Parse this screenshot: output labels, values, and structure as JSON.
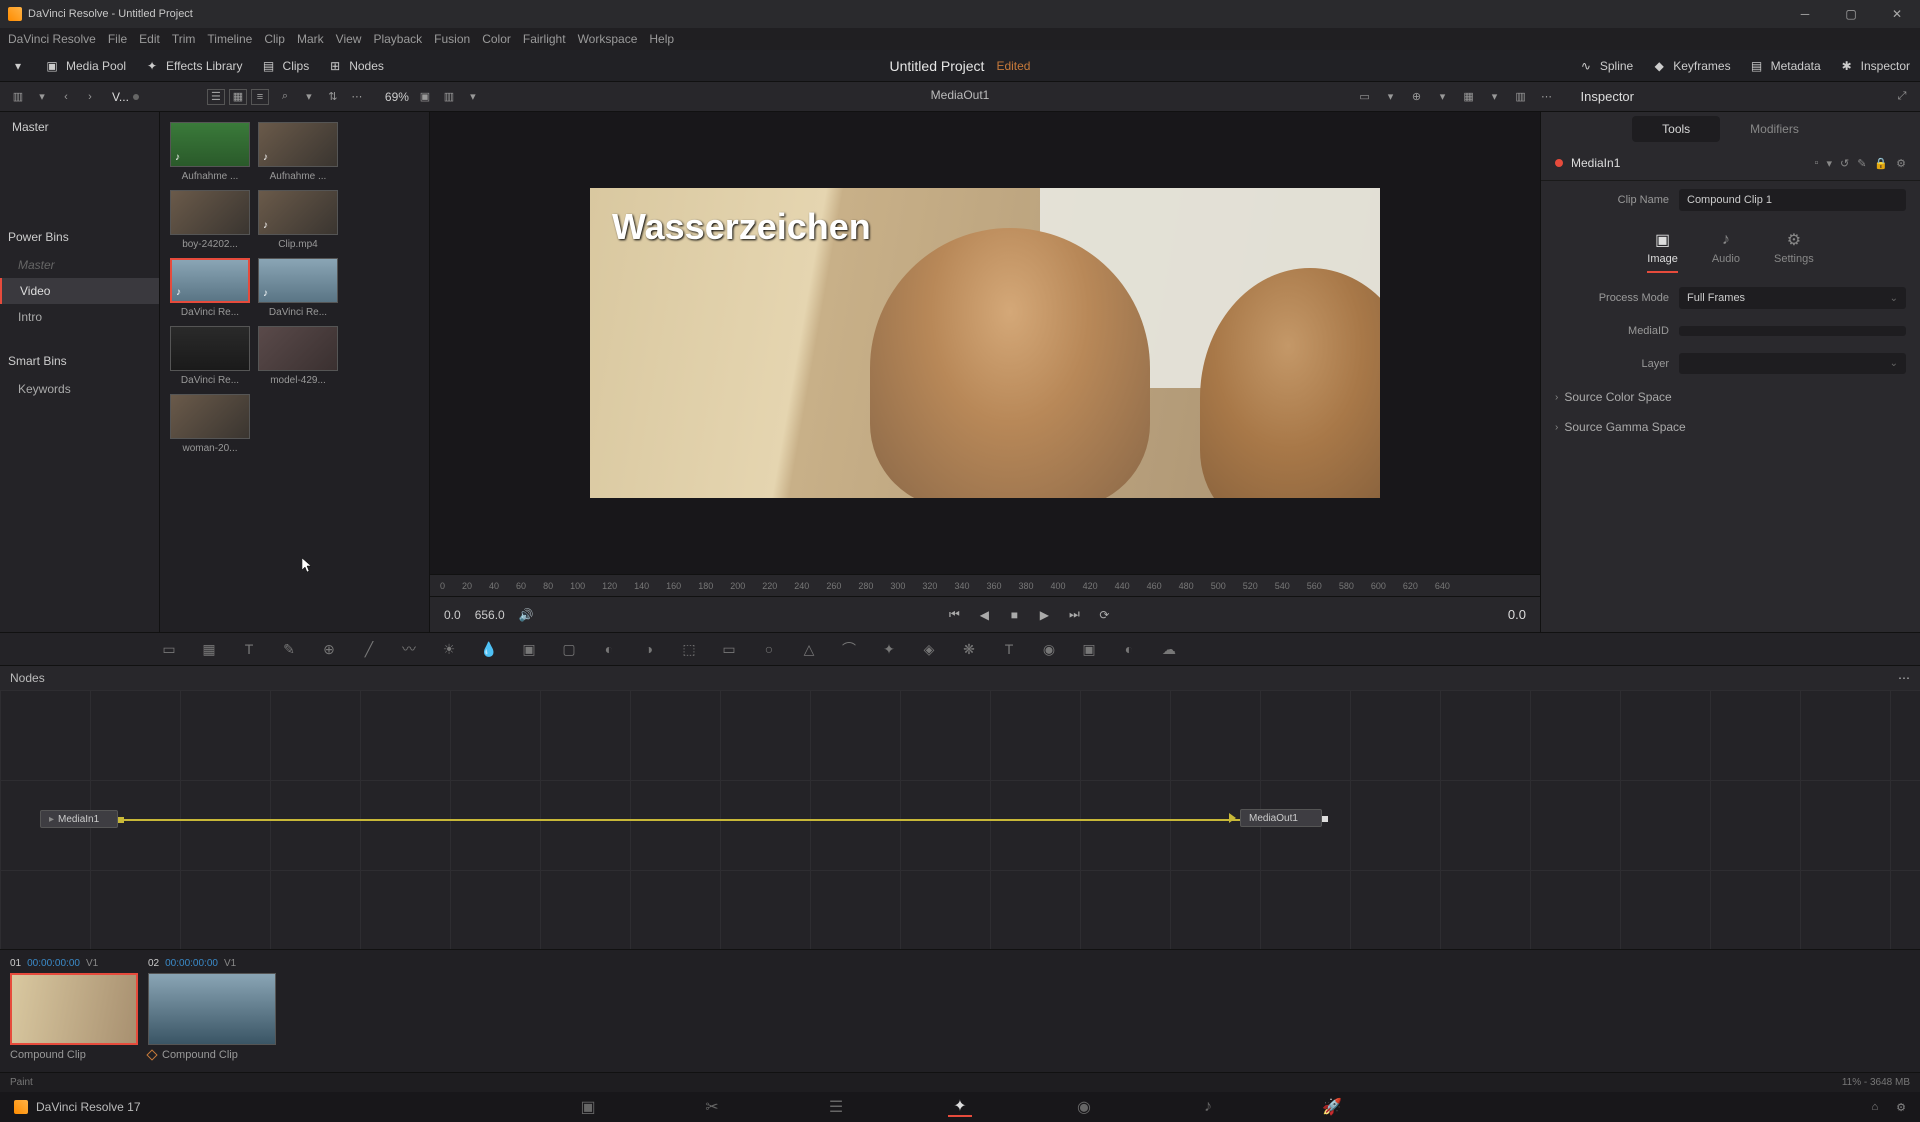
{
  "titlebar": {
    "title": "DaVinci Resolve - Untitled Project"
  },
  "menus": [
    "DaVinci Resolve",
    "File",
    "Edit",
    "Trim",
    "Timeline",
    "Clip",
    "Mark",
    "View",
    "Playback",
    "Fusion",
    "Color",
    "Fairlight",
    "Workspace",
    "Help"
  ],
  "shelf": {
    "left": [
      {
        "icon": "dropdown",
        "label": ""
      },
      {
        "icon": "media-pool",
        "label": "Media Pool"
      },
      {
        "icon": "effects",
        "label": "Effects Library"
      },
      {
        "icon": "clips",
        "label": "Clips"
      },
      {
        "icon": "nodes",
        "label": "Nodes"
      }
    ],
    "center": {
      "project": "Untitled Project",
      "status": "Edited"
    },
    "right": [
      {
        "icon": "spline",
        "label": "Spline"
      },
      {
        "icon": "keyframes",
        "label": "Keyframes"
      },
      {
        "icon": "metadata",
        "label": "Metadata"
      },
      {
        "icon": "inspector",
        "label": "Inspector"
      }
    ]
  },
  "toolbar2": {
    "vlabel": "V...",
    "zoom": "69%",
    "viewer_name": "MediaOut1",
    "inspector_label": "Inspector"
  },
  "sidebar": {
    "master": "Master",
    "powerbins_label": "Power Bins",
    "powerbins": [
      "Master",
      "Video",
      "Intro"
    ],
    "smartbins_label": "Smart Bins",
    "smartbins": [
      "Keywords"
    ]
  },
  "clips": [
    {
      "label": "Aufnahme ...",
      "cls": "green",
      "audio": true
    },
    {
      "label": "Aufnahme ...",
      "cls": "portrait",
      "audio": true
    },
    {
      "label": "boy-24202...",
      "cls": "portrait"
    },
    {
      "label": "Clip.mp4",
      "cls": "portrait",
      "audio": true
    },
    {
      "label": "DaVinci Re...",
      "cls": "landscape",
      "audio": true,
      "selected": true
    },
    {
      "label": "DaVinci Re...",
      "cls": "landscape",
      "audio": true
    },
    {
      "label": "DaVinci Re...",
      "cls": "dark"
    },
    {
      "label": "model-429...",
      "cls": "face"
    },
    {
      "label": "woman-20...",
      "cls": "portrait"
    }
  ],
  "viewer": {
    "watermark": "Wasserzeichen",
    "ruler": [
      "0",
      "20",
      "40",
      "60",
      "80",
      "100",
      "120",
      "140",
      "160",
      "180",
      "200",
      "220",
      "240",
      "260",
      "280",
      "300",
      "320",
      "340",
      "360",
      "380",
      "400",
      "420",
      "440",
      "460",
      "480",
      "500",
      "520",
      "540",
      "560",
      "580",
      "600",
      "620",
      "640"
    ],
    "tc_in": "0.0",
    "tc_dur": "656.0",
    "tc_out": "0.0"
  },
  "nodes": {
    "header": "Nodes",
    "in": "MediaIn1",
    "out": "MediaOut1"
  },
  "timeline_clips": [
    {
      "n": "01",
      "tc": "00:00:00:00",
      "track": "V1",
      "name": "Compound Clip",
      "cls": "couple",
      "selected": true
    },
    {
      "n": "02",
      "tc": "00:00:00:00",
      "track": "V1",
      "name": "Compound Clip",
      "cls": "lake"
    }
  ],
  "inspector": {
    "tabs": [
      "Tools",
      "Modifiers"
    ],
    "node_name": "MediaIn1",
    "clip_name_label": "Clip Name",
    "clip_name": "Compound Clip 1",
    "mode_tabs": [
      "Image",
      "Audio",
      "Settings"
    ],
    "fields": [
      {
        "label": "Process Mode",
        "value": "Full Frames",
        "type": "dropdown"
      },
      {
        "label": "MediaID",
        "value": "",
        "type": "text"
      },
      {
        "label": "Layer",
        "value": "",
        "type": "dropdown"
      }
    ],
    "collapsibles": [
      "Source Color Space",
      "Source Gamma Space"
    ]
  },
  "status": {
    "left": "Paint",
    "right": "11% - 3648 MB"
  },
  "pagenav": {
    "app": "DaVinci Resolve 17"
  }
}
